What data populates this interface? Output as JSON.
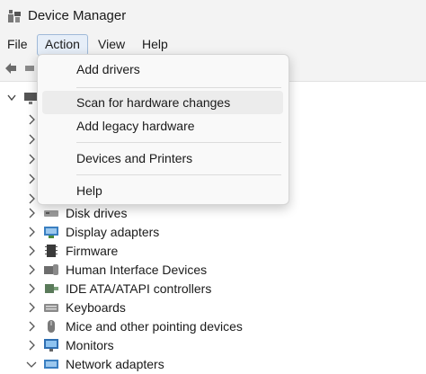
{
  "window": {
    "title": "Device Manager"
  },
  "menubar": {
    "file": "File",
    "action": "Action",
    "view": "View",
    "help": "Help"
  },
  "action_menu": {
    "add_drivers": "Add drivers",
    "scan": "Scan for hardware changes",
    "add_legacy": "Add legacy hardware",
    "devices_printers": "Devices and Printers",
    "help": "Help"
  },
  "tree": {
    "categories": [
      "Disk drives",
      "Display adapters",
      "Firmware",
      "Human Interface Devices",
      "IDE ATA/ATAPI controllers",
      "Keyboards",
      "Mice and other pointing devices",
      "Monitors",
      "Network adapters"
    ]
  },
  "colors": {
    "chrome_bg": "#f3f3f3",
    "menu_bg": "#f9f9f9",
    "active_menu": "#e6eef8"
  }
}
